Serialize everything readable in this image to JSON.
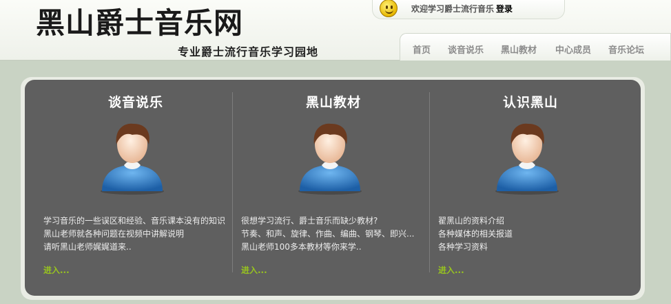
{
  "header": {
    "logo_text": "黑山爵士音乐网",
    "slogan": "专业爵士流行音乐学习园地",
    "welcome_text": "欢迎学习爵士流行音乐",
    "login_label": "登录",
    "smiley_icon": "smiley-face-icon"
  },
  "nav": {
    "items": [
      {
        "label": "首页"
      },
      {
        "label": "谈音说乐"
      },
      {
        "label": "黑山教材"
      },
      {
        "label": "中心成员"
      },
      {
        "label": "音乐论坛"
      }
    ]
  },
  "columns": [
    {
      "title": "谈音说乐",
      "icon": "user-avatar-icon",
      "lines": [
        "学习音乐的一些误区和经验、音乐课本没有的知识",
        "黑山老师就各种问题在视频中讲解说明",
        "请听黑山老师娓娓道来.."
      ],
      "enter_label": "进入..."
    },
    {
      "title": "黑山教材",
      "icon": "user-avatar-icon",
      "lines": [
        "很想学习流行、爵士音乐而缺少教材?",
        "节奏、和声、旋律、作曲、编曲、钢琴、即兴...",
        "黑山老师100多本教材等你来学.."
      ],
      "enter_label": "进入..."
    },
    {
      "title": "认识黑山",
      "icon": "user-avatar-icon",
      "lines": [
        "翟黑山的资料介绍",
        "各种媒体的相关报道",
        "各种学习资料"
      ],
      "enter_label": "进入..."
    }
  ],
  "colors": {
    "panel_bg": "#5f5f5f",
    "link_green": "#98c41f",
    "nav_text": "#8c8c8c"
  }
}
